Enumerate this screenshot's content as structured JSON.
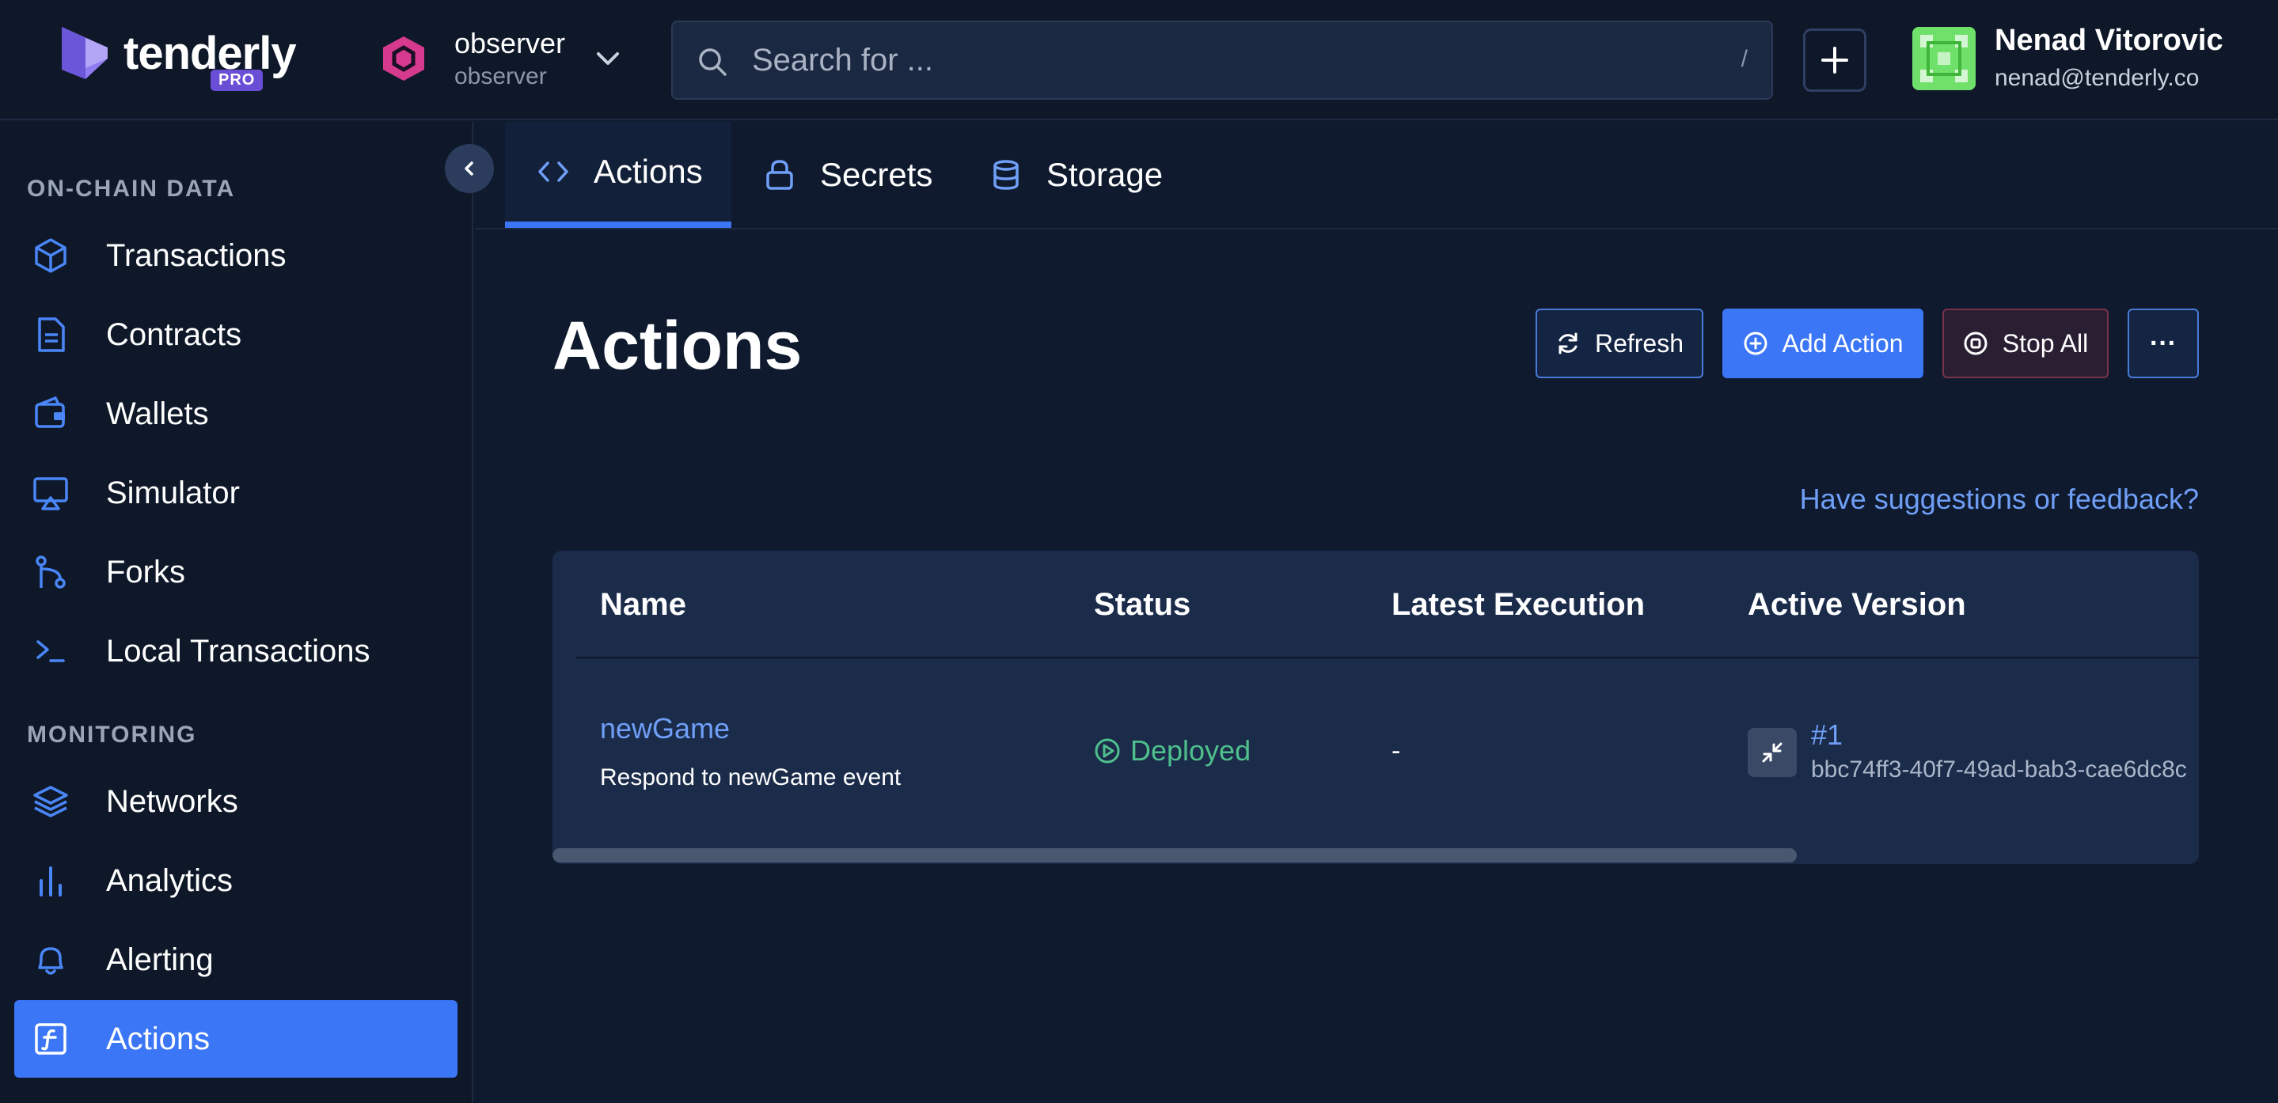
{
  "header": {
    "brand": "tenderly",
    "badge": "PRO",
    "project": {
      "name": "observer",
      "owner": "observer"
    },
    "search": {
      "placeholder": "Search for ...",
      "shortcut": "/"
    },
    "user": {
      "name": "Nenad Vitorovic",
      "email": "nenad@tenderly.co"
    }
  },
  "sidebar": {
    "sections": [
      {
        "title": "ON-CHAIN DATA",
        "items": [
          {
            "label": "Transactions",
            "icon": "cube-icon"
          },
          {
            "label": "Contracts",
            "icon": "document-icon"
          },
          {
            "label": "Wallets",
            "icon": "wallet-icon"
          },
          {
            "label": "Simulator",
            "icon": "screen-icon"
          },
          {
            "label": "Forks",
            "icon": "fork-icon"
          },
          {
            "label": "Local Transactions",
            "icon": "terminal-icon"
          }
        ]
      },
      {
        "title": "MONITORING",
        "items": [
          {
            "label": "Networks",
            "icon": "layers-icon"
          },
          {
            "label": "Analytics",
            "icon": "bar-chart-icon"
          },
          {
            "label": "Alerting",
            "icon": "bell-icon"
          },
          {
            "label": "Actions",
            "icon": "function-icon",
            "active": true
          }
        ]
      }
    ]
  },
  "tabs": [
    {
      "label": "Actions",
      "icon": "code-icon",
      "active": true
    },
    {
      "label": "Secrets",
      "icon": "lock-icon"
    },
    {
      "label": "Storage",
      "icon": "database-icon"
    }
  ],
  "main": {
    "title": "Actions",
    "buttons": {
      "refresh": "Refresh",
      "add": "Add Action",
      "stop": "Stop All",
      "more": "···"
    },
    "feedback": "Have suggestions or feedback?",
    "table": {
      "columns": [
        "Name",
        "Status",
        "Latest Execution",
        "Active Version"
      ],
      "rows": [
        {
          "name": "newGame",
          "description": "Respond to newGame event",
          "status": "Deployed",
          "latest_execution": "-",
          "version": "#1",
          "version_id": "bbc74ff3-40f7-49ad-bab3-cae6dc8c"
        }
      ]
    }
  },
  "colors": {
    "background": "#0f1a2e",
    "accent": "#3b76f6",
    "link": "#6f9ff7",
    "success": "#4fc08d",
    "danger_border": "#7a3248"
  }
}
